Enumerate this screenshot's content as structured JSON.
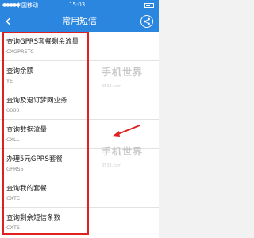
{
  "status_bar": {
    "carrier": "中国移动",
    "time": "15:03"
  },
  "nav": {
    "title": "常用短信",
    "back_icon": "chevron-left-icon",
    "share_icon": "share-icon"
  },
  "sms_items": [
    {
      "title": "查询GPRS套餐剩余流量",
      "code": "CXGPRSTC"
    },
    {
      "title": "查询余额",
      "code": "YE"
    },
    {
      "title": "查询及退订梦网业务",
      "code": "0000"
    },
    {
      "title": "查询数据流量",
      "code": "CXLL"
    },
    {
      "title": "办理5元GPRS套餐",
      "code": "GPRS5"
    },
    {
      "title": "查询我的套餐",
      "code": "CXTC"
    },
    {
      "title": "查询剩余短信条数",
      "code": "CXTS"
    }
  ],
  "watermark": {
    "brand": "手机世界",
    "site": "3533.com"
  },
  "colors": {
    "header": "#2b86e0",
    "annotation": "#e02020"
  }
}
